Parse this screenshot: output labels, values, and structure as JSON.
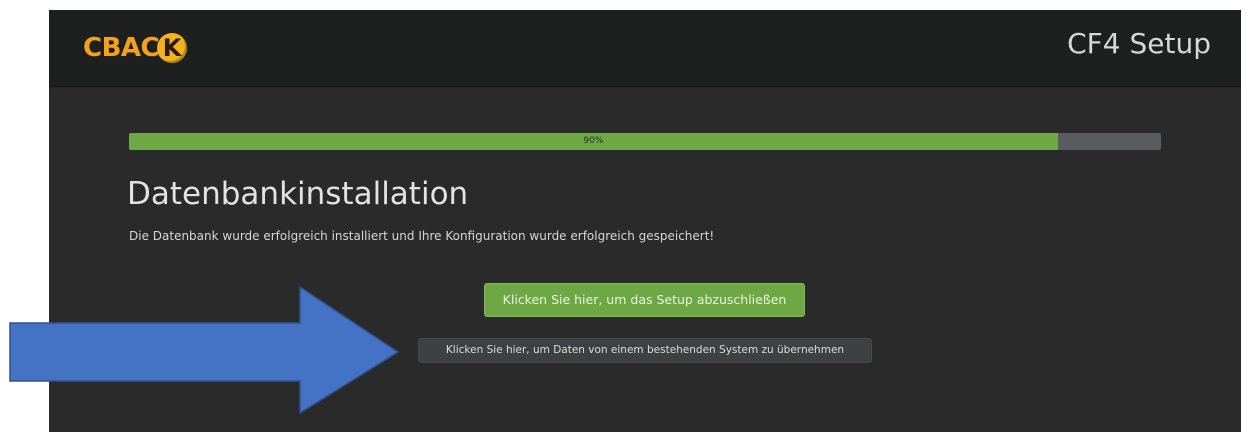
{
  "header": {
    "logo_text": "CBAC",
    "logo_badge_letter": "K",
    "title": "CF4 Setup"
  },
  "progress": {
    "label": "90%",
    "value_percent": 90
  },
  "main": {
    "title": "Datenbankinstallation",
    "message": "Die Datenbank wurde erfolgreich installiert und Ihre Konfiguration wurde erfolgreich gespeichert!"
  },
  "buttons": {
    "finish_label": "Klicken Sie hier, um das Setup abzuschließen",
    "import_label": "Klicken Sie hier, um Daten von einem bestehenden System zu übernehmen"
  },
  "colors": {
    "accent_green": "#6ea844",
    "logo_orange": "#f4a21c",
    "background_dark": "#2a2a2a",
    "arrow_blue": "#4472c4"
  }
}
